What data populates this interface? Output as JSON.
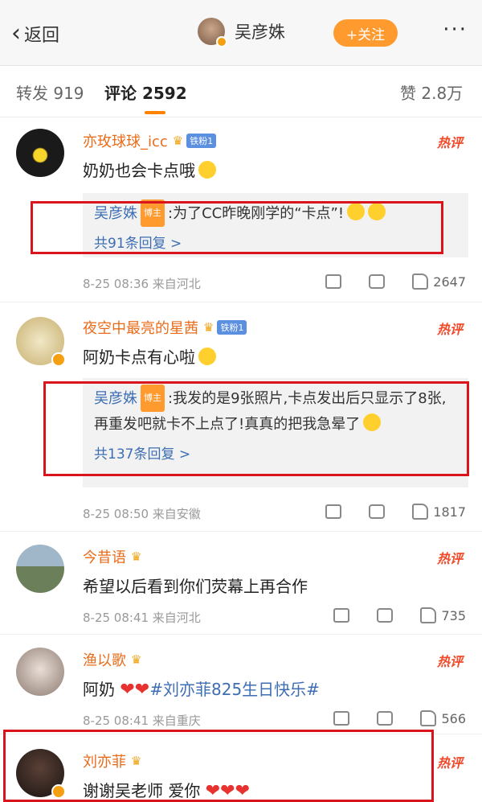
{
  "header": {
    "back_label": "返回",
    "title": "吴彦姝",
    "follow_label": "+关注",
    "more": "···"
  },
  "tabs": [
    {
      "label": "转发",
      "count": "919"
    },
    {
      "label": "评论",
      "count": "2592"
    },
    {
      "label": "赞",
      "count": "2.8万"
    }
  ],
  "comments": [
    {
      "name": "亦玫球球_icc",
      "fan": "铁粉1",
      "hot": "热评",
      "text": "奶奶也会卡点哦",
      "reply": {
        "name": "吴彦姝",
        "badge": "博主",
        "text": ":为了CC昨晚刚学的“卡点”!",
        "count": "共91条回复 >"
      },
      "meta": "8-25 08:36 来自河北",
      "likes": "2647"
    },
    {
      "name": "夜空中最亮的星茜",
      "fan": "铁粉1",
      "hot": "热评",
      "text": "阿奶卡点有心啦",
      "reply": {
        "name": "吴彦姝",
        "badge": "博主",
        "text": ":我发的是9张照片,卡点发出后只显示了8张,再重发吧就卡不上点了!真真的把我急晕了",
        "count": "共137条回复 >"
      },
      "meta": "8-25 08:50 来自安徽",
      "likes": "1817"
    },
    {
      "name": "今昔语",
      "hot": "热评",
      "text": "希望以后看到你们荧幕上再合作",
      "meta": "8-25 08:41 来自河北",
      "likes": "735"
    },
    {
      "name": "渔以歌",
      "hot": "热评",
      "text_prefix": "阿奶",
      "hashtag": "#刘亦菲825生日快乐#",
      "meta": "8-25 08:41 来自重庆",
      "likes": "566"
    },
    {
      "name": "刘亦菲",
      "hot": "热评",
      "text": "谢谢吴老师 爱你"
    }
  ],
  "accent": "#ff8200"
}
